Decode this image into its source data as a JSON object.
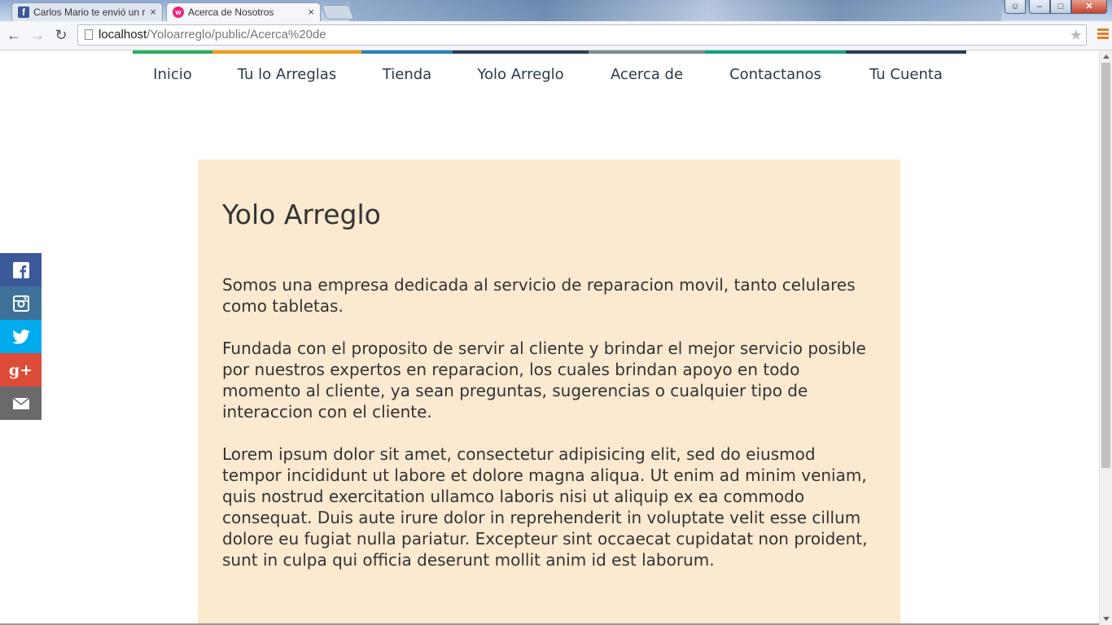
{
  "browser": {
    "tabs": [
      {
        "title": "Carlos Mario te envió un r",
        "favicon": "facebook-icon"
      },
      {
        "title": "Acerca de Nosotros",
        "favicon": "site-logo-icon"
      }
    ],
    "url_host": "localhost",
    "url_path": "/Yoloarreglo/public/Acerca%20de"
  },
  "nav": {
    "items": [
      {
        "label": "Inicio",
        "color": "#27ae60"
      },
      {
        "label": "Tu lo Arreglas",
        "color": "#f39c12"
      },
      {
        "label": "Tienda",
        "color": "#2980b9"
      },
      {
        "label": "Yolo Arreglo",
        "color": "#2c3e50"
      },
      {
        "label": "Acerca de",
        "color": "#7f8c8d"
      },
      {
        "label": "Contactanos",
        "color": "#16a085"
      },
      {
        "label": "Tu Cuenta",
        "color": "#2c3e50"
      }
    ]
  },
  "content": {
    "title": "Yolo Arreglo",
    "paragraphs": [
      "Somos una empresa dedicada al servicio de reparacion movil, tanto celulares como tabletas.",
      "Fundada con el proposito de servir al cliente y brindar el mejor servicio posible por nuestros expertos en reparacion, los cuales brindan apoyo en todo momento al cliente, ya sean preguntas, sugerencias o cualquier tipo de interaccion con el cliente.",
      "Lorem ipsum dolor sit amet, consectetur adipisicing elit, sed do eiusmod tempor incididunt ut labore et dolore magna aliqua. Ut enim ad minim veniam, quis nostrud exercitation ullamco laboris nisi ut aliquip ex ea commodo consequat. Duis aute irure dolor in reprehenderit in voluptate velit esse cillum dolore eu fugiat nulla pariatur. Excepteur sint occaecat cupidatat non proident, sunt in culpa qui officia deserunt mollit anim id est laborum."
    ]
  },
  "social": [
    {
      "name": "facebook",
      "icon": "facebook-icon",
      "color": "#3b5998"
    },
    {
      "name": "instagram",
      "icon": "instagram-icon",
      "color": "#3f729b"
    },
    {
      "name": "twitter",
      "icon": "twitter-icon",
      "color": "#00aced"
    },
    {
      "name": "google-plus",
      "icon": "google-plus-icon",
      "color": "#dd4b39"
    },
    {
      "name": "email",
      "icon": "mail-icon",
      "color": "#6a6a6a"
    }
  ]
}
